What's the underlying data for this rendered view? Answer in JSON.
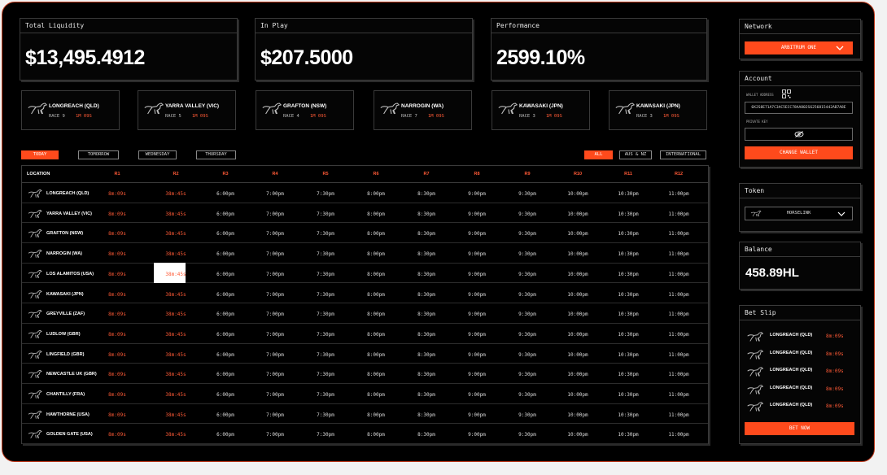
{
  "stats": [
    {
      "label": "Total Liquidity",
      "value": "$13,495.4912"
    },
    {
      "label": "In Play",
      "value": "$207.5000"
    },
    {
      "label": "Performance",
      "value": "2599.10%"
    }
  ],
  "races": [
    {
      "name": "LONGREACH (QLD)",
      "race": "RACE 9",
      "time": "1M 09S"
    },
    {
      "name": "YARRA VALLEY (VIC)",
      "race": "RACE 5",
      "time": "1M 09S"
    },
    {
      "name": "GRAFTON (NSW)",
      "race": "RACE 4",
      "time": "1M 09S"
    },
    {
      "name": "NARROGIN (WA)",
      "race": "RACE 7",
      "time": "1M 09S"
    },
    {
      "name": "KAWASAKI (JPN)",
      "race": "RACE 3",
      "time": "1M 09S"
    },
    {
      "name": "KAWASAKI (JPN)",
      "race": "RACE 3",
      "time": "1M 09S"
    }
  ],
  "day_tabs": [
    "TODAY",
    "TOMORROW",
    "WEDNESDAY",
    "THURSDAY"
  ],
  "region_tabs": [
    "ALL",
    "AUS & NZ",
    "INTERNATIONAL"
  ],
  "table": {
    "location_header": "LOCATION",
    "race_headers": [
      "R1",
      "R2",
      "R3",
      "R4",
      "R5",
      "R6",
      "R7",
      "R8",
      "R9",
      "R10",
      "R11",
      "R12"
    ],
    "times": [
      "8m:09s",
      "38m:45s",
      "6:00pm",
      "7:00pm",
      "7:30pm",
      "8:00pm",
      "8:30pm",
      "9:00pm",
      "9:30pm",
      "10:00pm",
      "10:30pm",
      "11:00pm"
    ],
    "rows": [
      {
        "location": "LONGREACH (QLD)"
      },
      {
        "location": "YARRA VALLEY (VIC)"
      },
      {
        "location": "GRAFTON (NSW)"
      },
      {
        "location": "NARROGIN (WA)"
      },
      {
        "location": "LOS ALAMITOS (USA)"
      },
      {
        "location": "KAWASAKI (JPN)"
      },
      {
        "location": "GREYVILLE (ZAF)"
      },
      {
        "location": "LUDLOW (GBR)"
      },
      {
        "location": "LINGFIELD (GBR)"
      },
      {
        "location": "NEWCASTLE UK (GBR)"
      },
      {
        "location": "CHANTILLY (FRA)"
      },
      {
        "location": "HAWTHORNE (USA)"
      },
      {
        "location": "GOLDEN GATE (USA)"
      }
    ]
  },
  "network": {
    "title": "Network",
    "selected": "ARBITRUM ONE"
  },
  "account": {
    "title": "Account",
    "wallet_label": "WALLET ADDRESS",
    "wallet_value": "0X2S8E71A7C3AC5ECC78AA802S6256815442AB7A8E",
    "key_label": "PRIVATE KEY",
    "change_wallet": "CHANGE WALLET"
  },
  "token": {
    "title": "Token",
    "selected": "HORSELINK"
  },
  "balance": {
    "title": "Balance",
    "value": "458.89HL"
  },
  "bet_slip": {
    "title": "Bet Slip",
    "items": [
      {
        "name": "LONGREACH (QLD)",
        "time": "8m:09s"
      },
      {
        "name": "LONGREACH (QLD)",
        "time": "8m:09s"
      },
      {
        "name": "LONGREACH (QLD)",
        "time": "8m:09s"
      },
      {
        "name": "LONGREACH (QLD)",
        "time": "8m:09s"
      },
      {
        "name": "LONGREACH (QLD)",
        "time": "8m:09s"
      }
    ],
    "bet_button": "BET NOW"
  },
  "colors": {
    "accent": "#ff4a1c",
    "accent_text": "#ff5a36",
    "bg": "#000000",
    "border": "#3a3a3a"
  },
  "icons": {
    "horse": "horse-icon",
    "chevron": "chevron-down-icon",
    "qr": "qr-code-icon",
    "eye": "eye-off-icon"
  }
}
